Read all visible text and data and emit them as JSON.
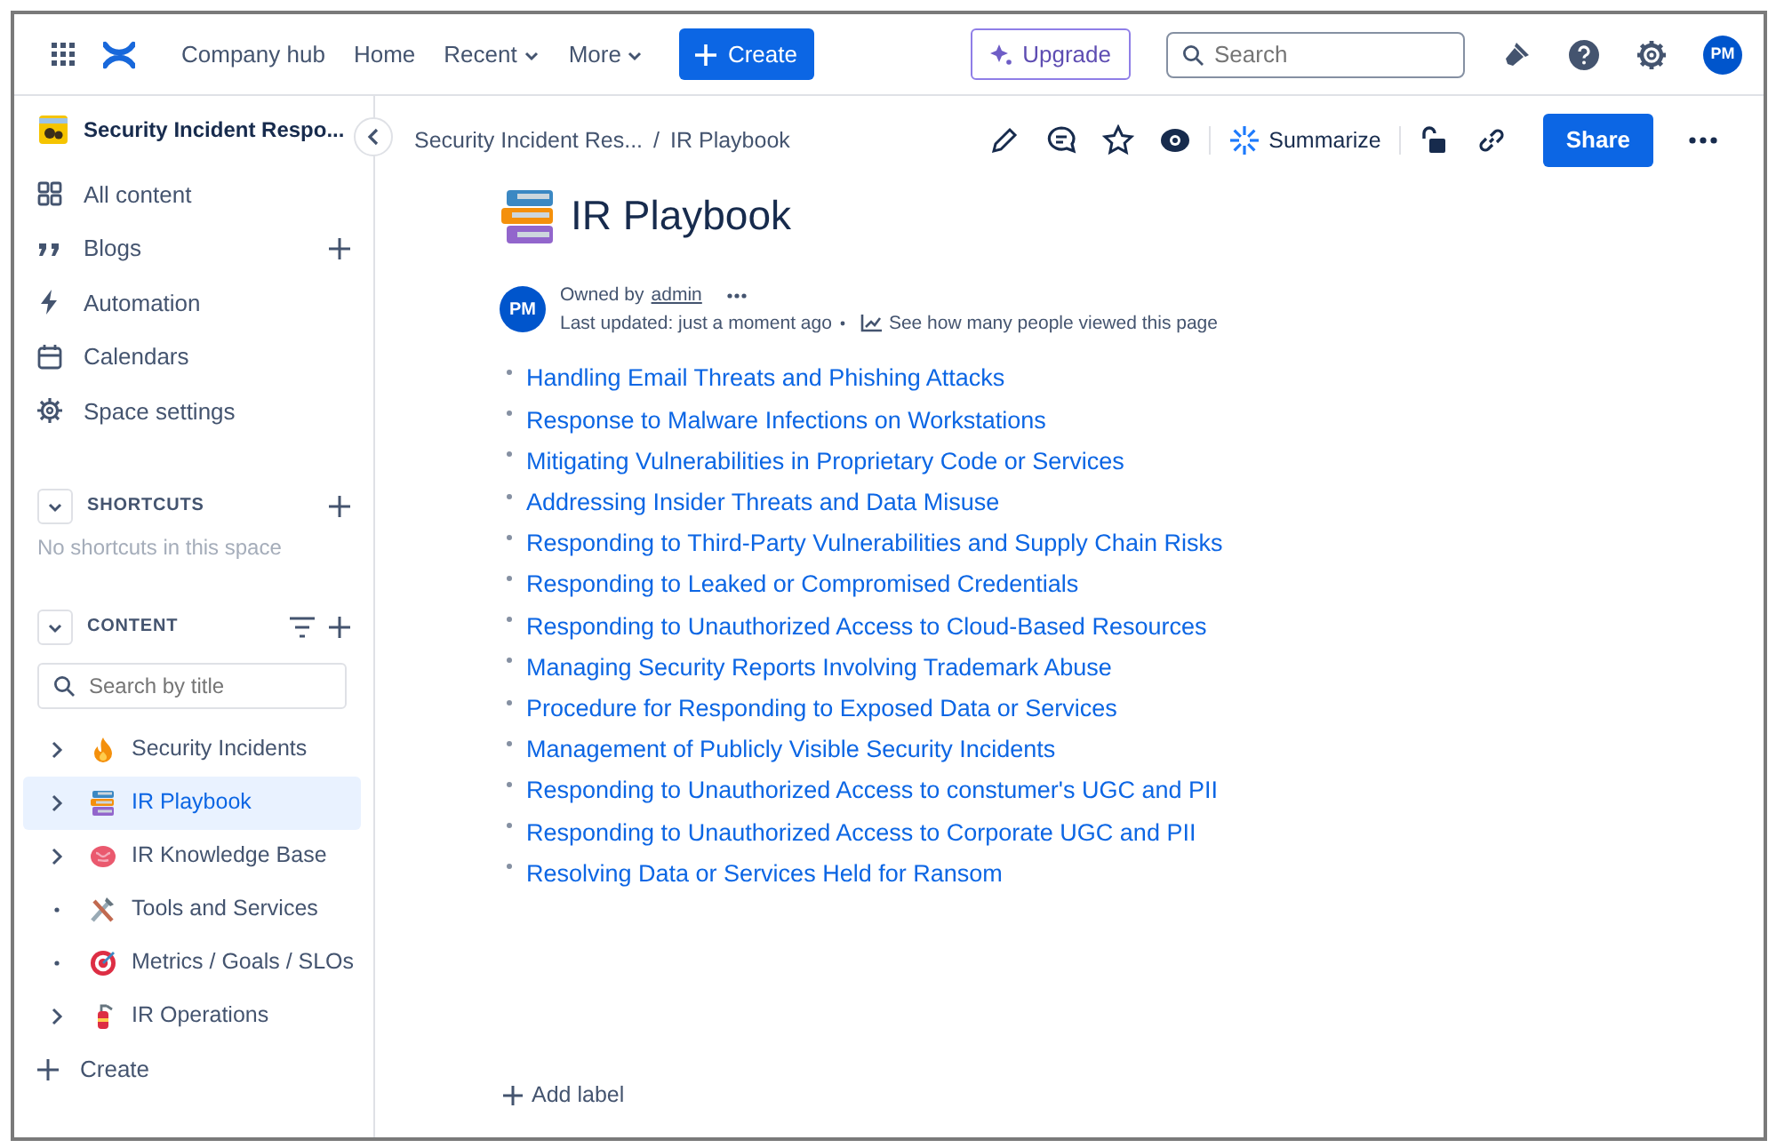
{
  "topnav": {
    "links": [
      {
        "label": "Company hub",
        "dropdown": false
      },
      {
        "label": "Home",
        "dropdown": false
      },
      {
        "label": "Recent",
        "dropdown": true
      },
      {
        "label": "More",
        "dropdown": true
      }
    ],
    "create": "Create",
    "upgrade": "Upgrade",
    "search": {
      "placeholder": "Search"
    },
    "avatar": "PM"
  },
  "sidebar": {
    "space_title": "Security Incident Respo...",
    "nav": [
      {
        "label": "All content",
        "add": false
      },
      {
        "label": "Blogs",
        "add": true
      },
      {
        "label": "Automation",
        "add": false
      },
      {
        "label": "Calendars",
        "add": false
      },
      {
        "label": "Space settings",
        "add": false
      }
    ],
    "shortcuts": {
      "heading": "SHORTCUTS",
      "empty": "No shortcuts in this space"
    },
    "content": {
      "heading": "CONTENT",
      "search": {
        "placeholder": "Search by title"
      },
      "tree": [
        {
          "label": "Security Incidents",
          "expandable": true,
          "selected": false
        },
        {
          "label": "IR Playbook",
          "expandable": true,
          "selected": true
        },
        {
          "label": "IR Knowledge Base",
          "expandable": true,
          "selected": false
        },
        {
          "label": "Tools and Services",
          "expandable": false,
          "selected": false
        },
        {
          "label": "Metrics / Goals / SLOs",
          "expandable": false,
          "selected": false
        },
        {
          "label": "IR Operations",
          "expandable": true,
          "selected": false
        }
      ],
      "create": "Create"
    }
  },
  "breadcrumbs": [
    "Security Incident Res...",
    "IR Playbook"
  ],
  "breadcrumb_separator": "/",
  "toolbar": {
    "summarize": "Summarize",
    "share": "Share"
  },
  "page": {
    "title": "IR Playbook",
    "byline": {
      "avatar": "PM",
      "owned_by": "Owned by",
      "owner": "admin",
      "updated": "Last updated: just a moment ago",
      "views": "See how many people viewed this page"
    },
    "links": [
      "Handling Email Threats and Phishing Attacks",
      "Response to Malware Infections on Workstations",
      "Mitigating Vulnerabilities in Proprietary Code or Services",
      "Addressing Insider Threats and Data Misuse",
      "Responding to Third-Party Vulnerabilities and Supply Chain Risks",
      "Responding to Leaked or Compromised Credentials",
      "Responding to Unauthorized Access to Cloud-Based Resources",
      "Managing Security Reports Involving Trademark Abuse",
      "Procedure for Responding to Exposed Data or Services",
      "Management of Publicly Visible Security Incidents",
      "Responding to Unauthorized Access to constumer's UGC and PII",
      "Responding to Unauthorized Access to Corporate UGC and PII",
      "Resolving Data or Services Held for Ransom"
    ],
    "add_label": "Add label"
  }
}
